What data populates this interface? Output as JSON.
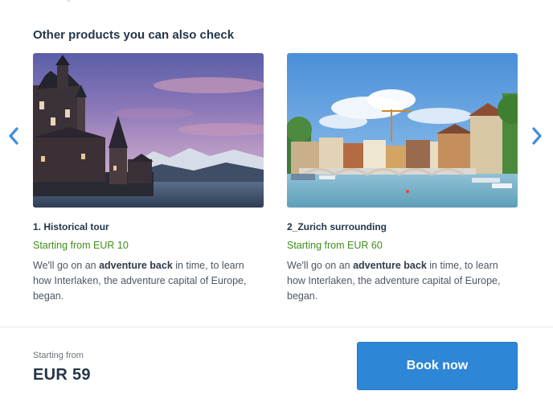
{
  "section": {
    "title": "Other products you can also check"
  },
  "carousel": {
    "prev_icon": "chevron-left-icon",
    "next_icon": "chevron-right-icon",
    "accent_color": "#3f8fd6"
  },
  "products": [
    {
      "title": "1. Historical tour",
      "price": "Starting from EUR 10",
      "desc_pre": "We'll go on an ",
      "desc_bold": "adventure back",
      "desc_post": " in time, to learn how Interlaken, the adventure capital of Europe, began."
    },
    {
      "title": "2_Zurich surrounding",
      "price": "Starting from EUR 60",
      "desc_pre": "We'll go on an ",
      "desc_bold": "adventure back",
      "desc_post": " in time, to learn how Interlaken, the adventure capital of Europe, began."
    }
  ],
  "footer": {
    "from_label": "Starting from",
    "from_price": "EUR 59",
    "book_label": "Book now"
  },
  "colors": {
    "price_green": "#3f8e1c",
    "button_blue": "#2d86d6",
    "heading": "#24364a"
  }
}
